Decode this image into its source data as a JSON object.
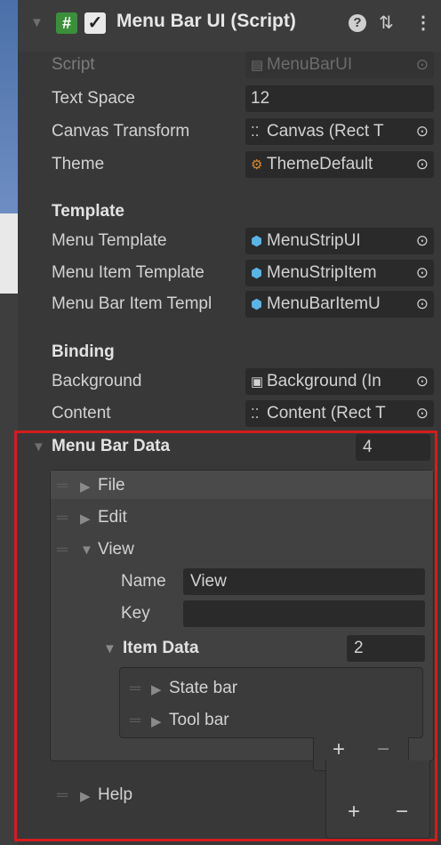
{
  "component": {
    "title": "Menu Bar UI (Script)",
    "enabled_check": "✓",
    "hash_glyph": "#",
    "help_glyph": "?",
    "preset_glyph": "⇅",
    "more_glyph": "⋮"
  },
  "props": {
    "script_label": "Script",
    "script_value": "MenuBarUI",
    "text_space_label": "Text Space",
    "text_space_value": "12",
    "canvas_label": "Canvas Transform",
    "canvas_value": "Canvas (Rect T",
    "theme_label": "Theme",
    "theme_value": "ThemeDefault"
  },
  "template": {
    "header": "Template",
    "menu_label": "Menu Template",
    "menu_value": "MenuStripUI",
    "item_label": "Menu Item Template",
    "item_value": "MenuStripItem",
    "bar_item_label": "Menu Bar Item Templ",
    "bar_item_value": "MenuBarItemU"
  },
  "binding": {
    "header": "Binding",
    "background_label": "Background",
    "background_value": "Background (In",
    "content_label": "Content",
    "content_value": "Content (Rect T"
  },
  "menu_bar_data": {
    "label": "Menu Bar Data",
    "count": "4",
    "items": [
      "File",
      "Edit",
      "View",
      "Help"
    ],
    "view": {
      "name_label": "Name",
      "name_value": "View",
      "key_label": "Key",
      "key_value": "",
      "item_data_label": "Item Data",
      "item_data_count": "2",
      "sub_items": [
        "State bar",
        "Tool bar"
      ]
    },
    "add": "+",
    "remove": "−"
  },
  "colors": {
    "highlight_border": "#d41c1c",
    "script_icon_green": "#3b8f3a"
  }
}
